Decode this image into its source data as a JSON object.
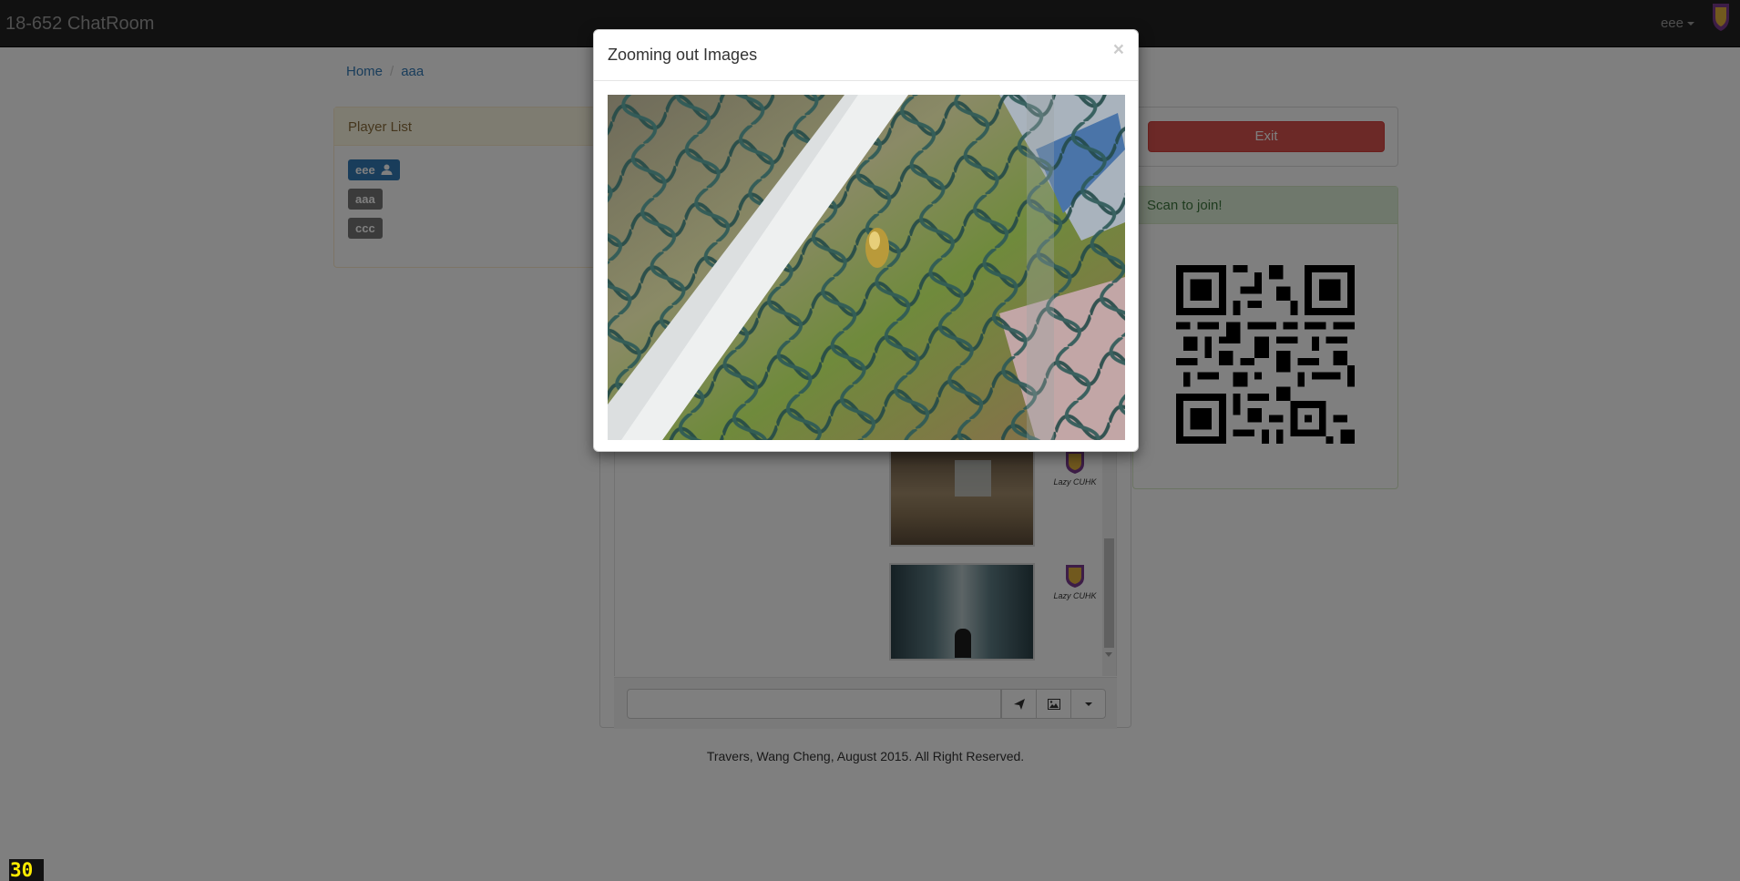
{
  "navbar": {
    "brand": "18-652 ChatRoom",
    "user": "eee"
  },
  "breadcrumb": {
    "home": "Home",
    "current": "aaa"
  },
  "players": {
    "heading": "Player List",
    "items": [
      {
        "name": "eee",
        "is_me": true
      },
      {
        "name": "aaa",
        "is_me": false
      },
      {
        "name": "ccc",
        "is_me": false
      }
    ]
  },
  "exit_label": "Exit",
  "qr": {
    "heading": "Scan to join!"
  },
  "chat": {
    "avatar_caption": "Lazy CUHK",
    "input_value": ""
  },
  "footer": "Travers, Wang Cheng, August 2015. All Right Reserved.",
  "fps_counter": "30",
  "modal": {
    "title": "Zooming out Images",
    "close": "×"
  },
  "colors": {
    "navbar": "#222222",
    "danger": "#d9534f",
    "primary": "#337ab7",
    "success_bg": "#dff0d8",
    "warning_bg": "#fcf8e3"
  }
}
